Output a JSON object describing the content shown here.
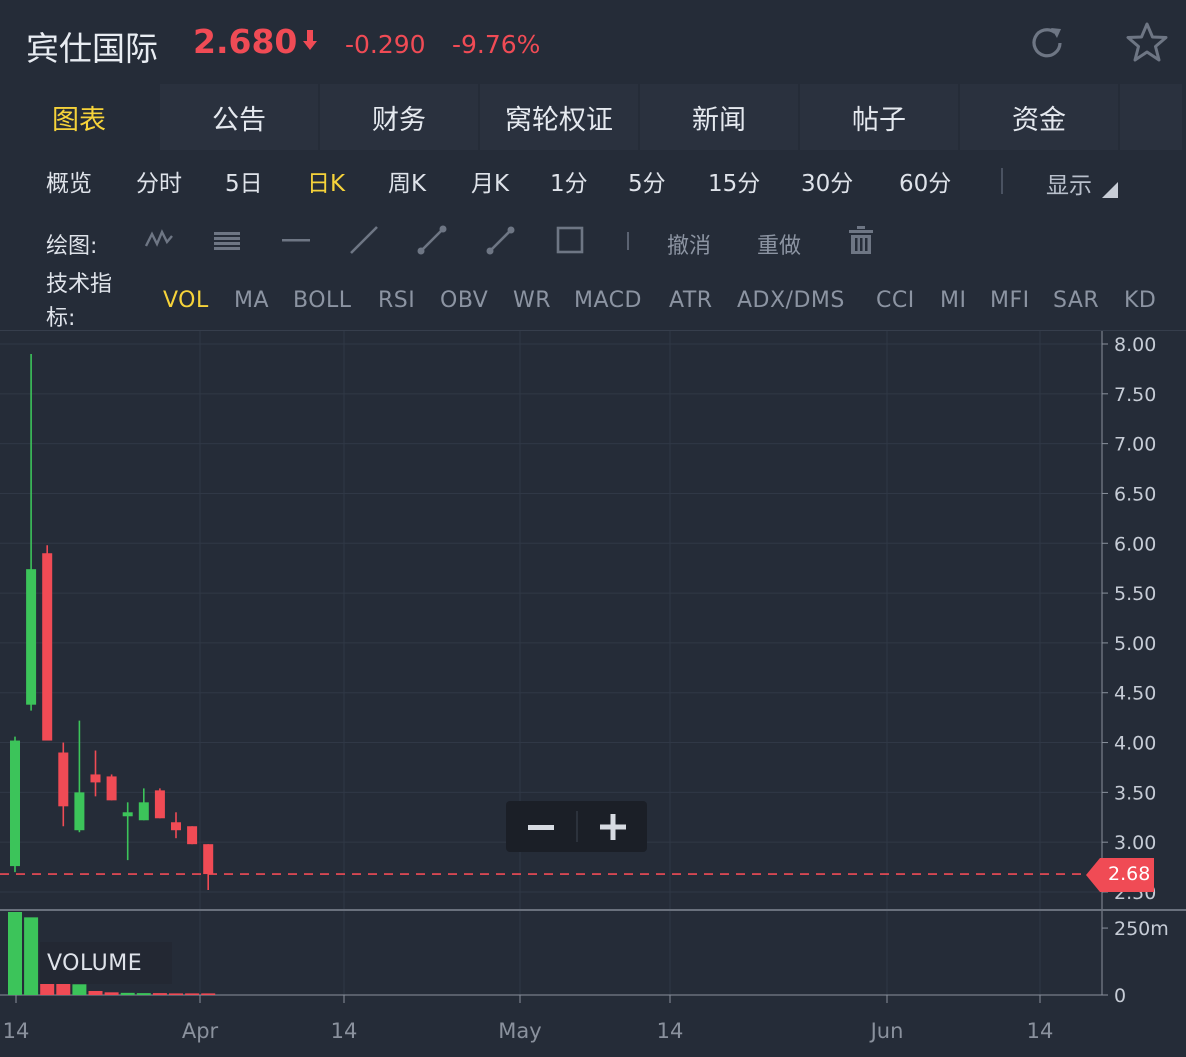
{
  "header": {
    "stock_name": "宾仕国际",
    "price": "2.680",
    "change": "-0.290",
    "change_pct": "-9.76%",
    "colors": {
      "down": "#f04b55",
      "up": "#3cc45a",
      "accent": "#f6d33a"
    },
    "icons": [
      "refresh-icon",
      "star-icon",
      "down-arrow-icon"
    ]
  },
  "tabs": [
    "图表",
    "公告",
    "财务",
    "窝轮权证",
    "新闻",
    "帖子",
    "资金"
  ],
  "periods": [
    "概览",
    "分时",
    "5日",
    "日K",
    "周K",
    "月K",
    "1分",
    "5分",
    "15分",
    "30分",
    "60分"
  ],
  "active_period": "日K",
  "display_label": "显示",
  "draw": {
    "label": "绘图:",
    "undo": "撤消",
    "redo": "重做",
    "tools": [
      "wave-line-icon",
      "horizontal-bars-icon",
      "horizontal-line-icon",
      "diagonal-line-icon",
      "segment-line-icon",
      "ray-line-icon",
      "rectangle-icon",
      "trash-icon"
    ]
  },
  "indicators": {
    "label": "技术指标:",
    "items": [
      "VOL",
      "MA",
      "BOLL",
      "RSI",
      "OBV",
      "WR",
      "MACD",
      "ATR",
      "ADX/DMS",
      "CCI",
      "MI",
      "MFI",
      "SAR",
      "KD"
    ],
    "active": "VOL"
  },
  "chart_data": {
    "type": "candlestick",
    "y_ticks": [
      "8.00",
      "7.50",
      "7.00",
      "6.50",
      "6.00",
      "5.50",
      "5.00",
      "4.50",
      "4.00",
      "3.50",
      "3.00",
      "2.50"
    ],
    "ylim": [
      2.5,
      8.0
    ],
    "x_ticks": [
      "14",
      "Apr",
      "14",
      "May",
      "14",
      "Jun",
      "14"
    ],
    "current_price": "2.68",
    "volume_label": "VOLUME",
    "volume_ticks": [
      "250m",
      "0"
    ],
    "candles": [
      {
        "open": 2.76,
        "high": 4.06,
        "low": 2.7,
        "close": 4.02,
        "volume": 310
      },
      {
        "open": 4.38,
        "high": 7.9,
        "low": 4.32,
        "close": 5.74,
        "volume": 290
      },
      {
        "open": 5.9,
        "high": 5.98,
        "low": 4.02,
        "close": 4.02,
        "volume": 70
      },
      {
        "open": 3.9,
        "high": 4.0,
        "low": 3.16,
        "close": 3.36,
        "volume": 50
      },
      {
        "open": 3.12,
        "high": 4.22,
        "low": 3.1,
        "close": 3.5,
        "volume": 40
      },
      {
        "open": 3.68,
        "high": 3.92,
        "low": 3.46,
        "close": 3.6,
        "volume": 15
      },
      {
        "open": 3.66,
        "high": 3.68,
        "low": 3.42,
        "close": 3.42,
        "volume": 10
      },
      {
        "open": 3.26,
        "high": 3.4,
        "low": 2.82,
        "close": 3.3,
        "volume": 8
      },
      {
        "open": 3.22,
        "high": 3.54,
        "low": 3.22,
        "close": 3.4,
        "volume": 7
      },
      {
        "open": 3.52,
        "high": 3.54,
        "low": 3.24,
        "close": 3.24,
        "volume": 7
      },
      {
        "open": 3.2,
        "high": 3.3,
        "low": 3.04,
        "close": 3.12,
        "volume": 6
      },
      {
        "open": 3.16,
        "high": 3.16,
        "low": 2.98,
        "close": 2.98,
        "volume": 6
      },
      {
        "open": 2.98,
        "high": 2.98,
        "low": 2.52,
        "close": 2.68,
        "volume": 6
      }
    ]
  }
}
